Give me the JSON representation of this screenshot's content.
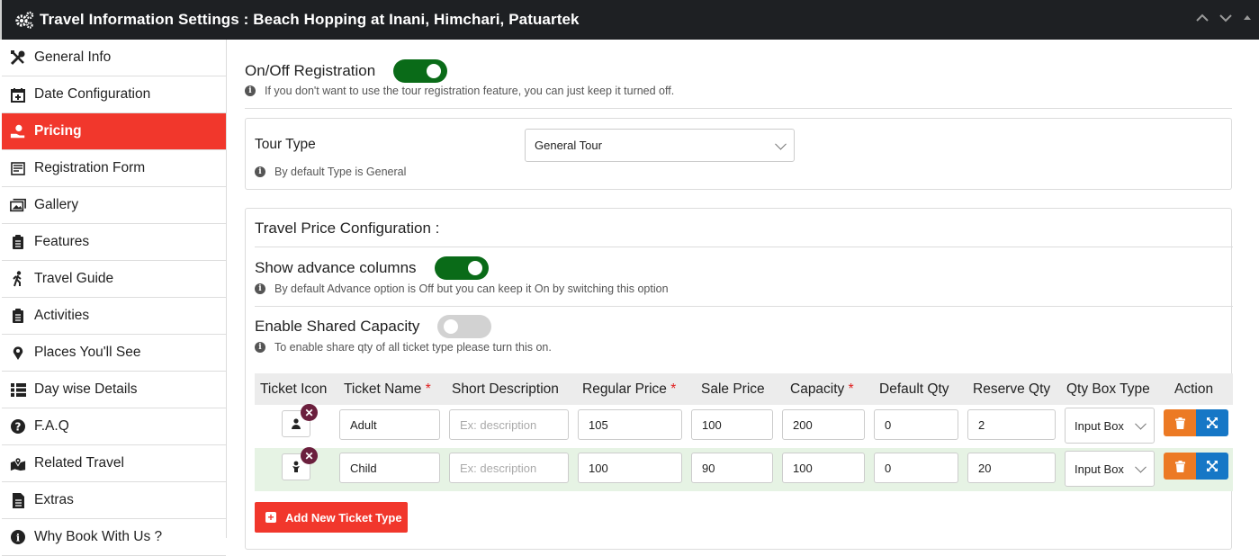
{
  "header": {
    "title": "Travel Information Settings : Beach Hopping at Inani, Himchari, Patuartek"
  },
  "sidebar": {
    "items": [
      {
        "label": "General Info",
        "icon": "tools-icon"
      },
      {
        "label": "Date Configuration",
        "icon": "calendar-plus-icon"
      },
      {
        "label": "Pricing",
        "icon": "hand-money-icon",
        "active": true
      },
      {
        "label": "Registration Form",
        "icon": "form-icon"
      },
      {
        "label": "Gallery",
        "icon": "images-icon"
      },
      {
        "label": "Features",
        "icon": "clipboard-icon"
      },
      {
        "label": "Travel Guide",
        "icon": "hiker-icon"
      },
      {
        "label": "Activities",
        "icon": "clipboard-icon"
      },
      {
        "label": "Places You'll See",
        "icon": "map-pin-icon"
      },
      {
        "label": "Day wise Details",
        "icon": "list-icon"
      },
      {
        "label": "F.A.Q",
        "icon": "question-circle-icon"
      },
      {
        "label": "Related Travel",
        "icon": "map-location-icon"
      },
      {
        "label": "Extras",
        "icon": "file-icon"
      },
      {
        "label": "Why Book With Us ?",
        "icon": "info-circle-icon"
      }
    ]
  },
  "registration": {
    "label": "On/Off Registration",
    "enabled": true,
    "info": "If you don't want to use the tour registration feature, you can just keep it turned off."
  },
  "tour_type": {
    "label": "Tour Type",
    "value": "General Tour",
    "info": "By default Type is General"
  },
  "price_config": {
    "title": "Travel Price Configuration :",
    "advance": {
      "label": "Show advance columns",
      "enabled": true,
      "info": "By default Advance option is Off but you can keep it On by switching this option"
    },
    "shared": {
      "label": "Enable Shared Capacity",
      "enabled": false,
      "info": "To enable share qty of all ticket type please turn this on."
    },
    "columns": [
      {
        "label": "Ticket Icon",
        "required": false
      },
      {
        "label": "Ticket Name",
        "required": true
      },
      {
        "label": "Short Description",
        "required": false
      },
      {
        "label": "Regular Price",
        "required": true
      },
      {
        "label": "Sale Price",
        "required": false
      },
      {
        "label": "Capacity",
        "required": true
      },
      {
        "label": "Default Qty",
        "required": false
      },
      {
        "label": "Reserve Qty",
        "required": false
      },
      {
        "label": "Qty Box Type",
        "required": false
      },
      {
        "label": "Action",
        "required": false
      }
    ],
    "rows": [
      {
        "icon": "user-icon",
        "name": "Adult",
        "description_placeholder": "Ex: description",
        "regular_price": "105",
        "sale_price": "100",
        "capacity": "200",
        "default_qty": "0",
        "reserve_qty": "2",
        "box_type": "Input Box"
      },
      {
        "icon": "child-icon",
        "name": "Child",
        "description_placeholder": "Ex: description",
        "regular_price": "100",
        "sale_price": "90",
        "capacity": "100",
        "default_qty": "0",
        "reserve_qty": "20",
        "box_type": "Input Box"
      }
    ],
    "add_button": "Add New Ticket Type",
    "required_mark": "*"
  },
  "colors": {
    "accent": "#f1372c",
    "toggle_on": "#0a6b18",
    "header_bg": "#1e2023",
    "delete": "#ec7a24",
    "move": "#1677c6"
  }
}
